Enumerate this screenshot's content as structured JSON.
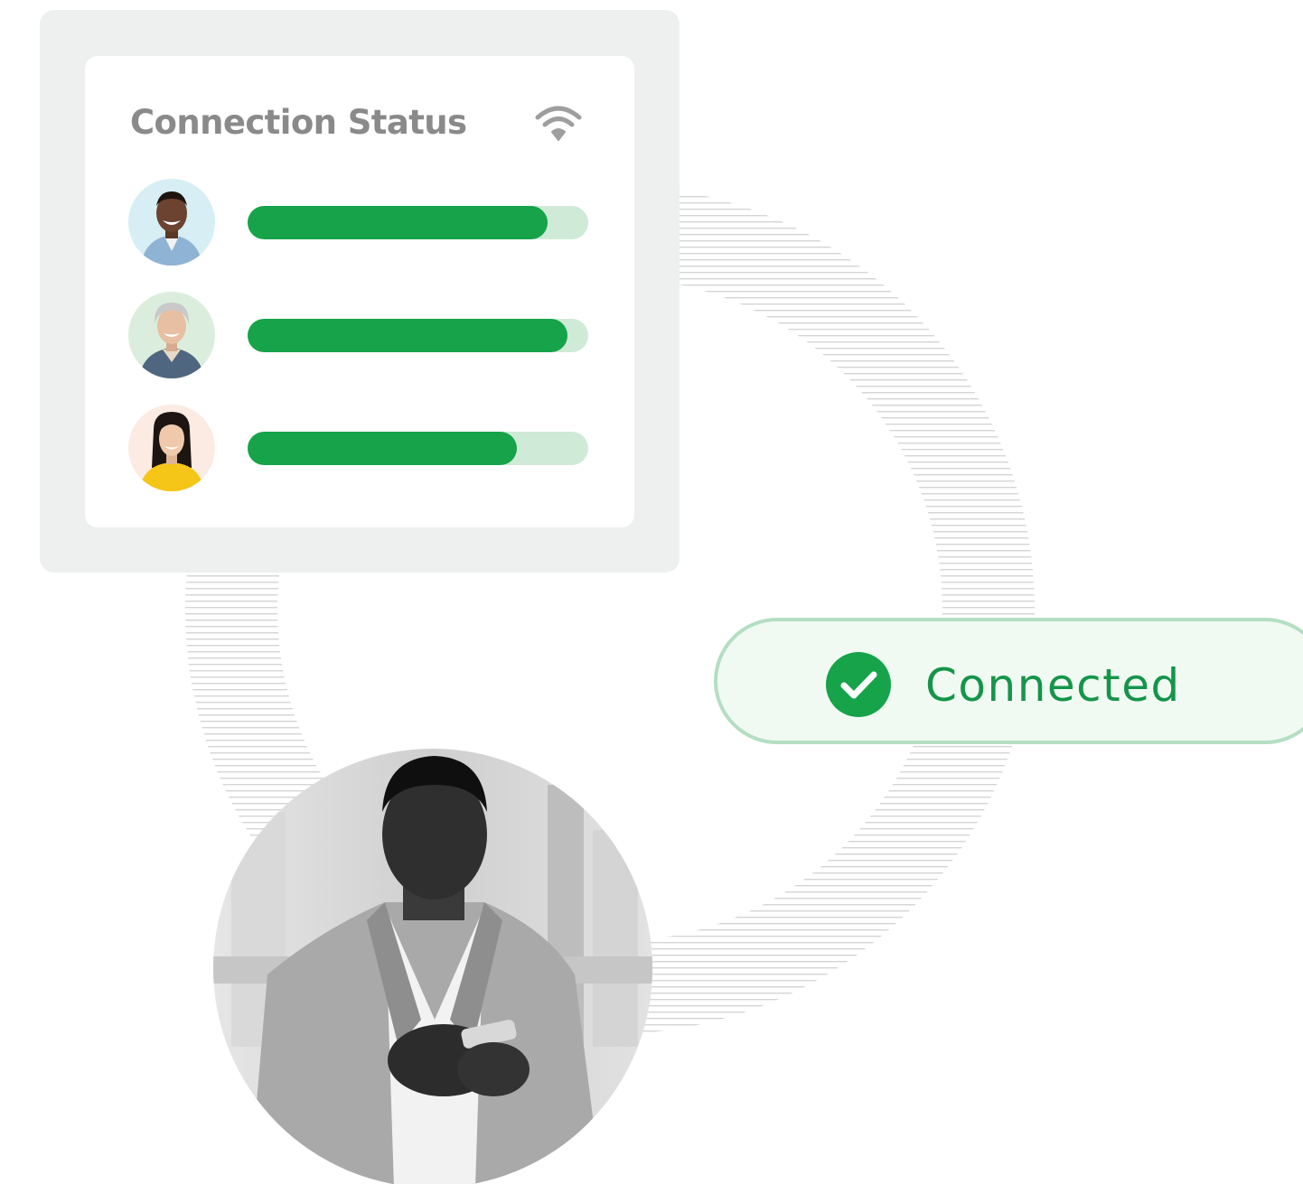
{
  "card": {
    "title": "Connection Status",
    "header_icon": "wifi-icon"
  },
  "users": [
    {
      "avatar": "avatar-smiling-man",
      "strength": 0.88
    },
    {
      "avatar": "avatar-gray-haired-woman",
      "strength": 0.94
    },
    {
      "avatar": "avatar-woman-yellow-top",
      "strength": 0.79
    }
  ],
  "status": {
    "label": "Connected",
    "icon": "check-circle-icon"
  },
  "photo": {
    "subject": "man-looking-at-phone-photo"
  },
  "colors": {
    "accent": "#16a34a",
    "track": "#cfead7",
    "pill_background": "#f0faf3",
    "pill_border": "#b5dec3",
    "title_gray": "#8a8a8a",
    "card_gray": "#eef0ef"
  }
}
